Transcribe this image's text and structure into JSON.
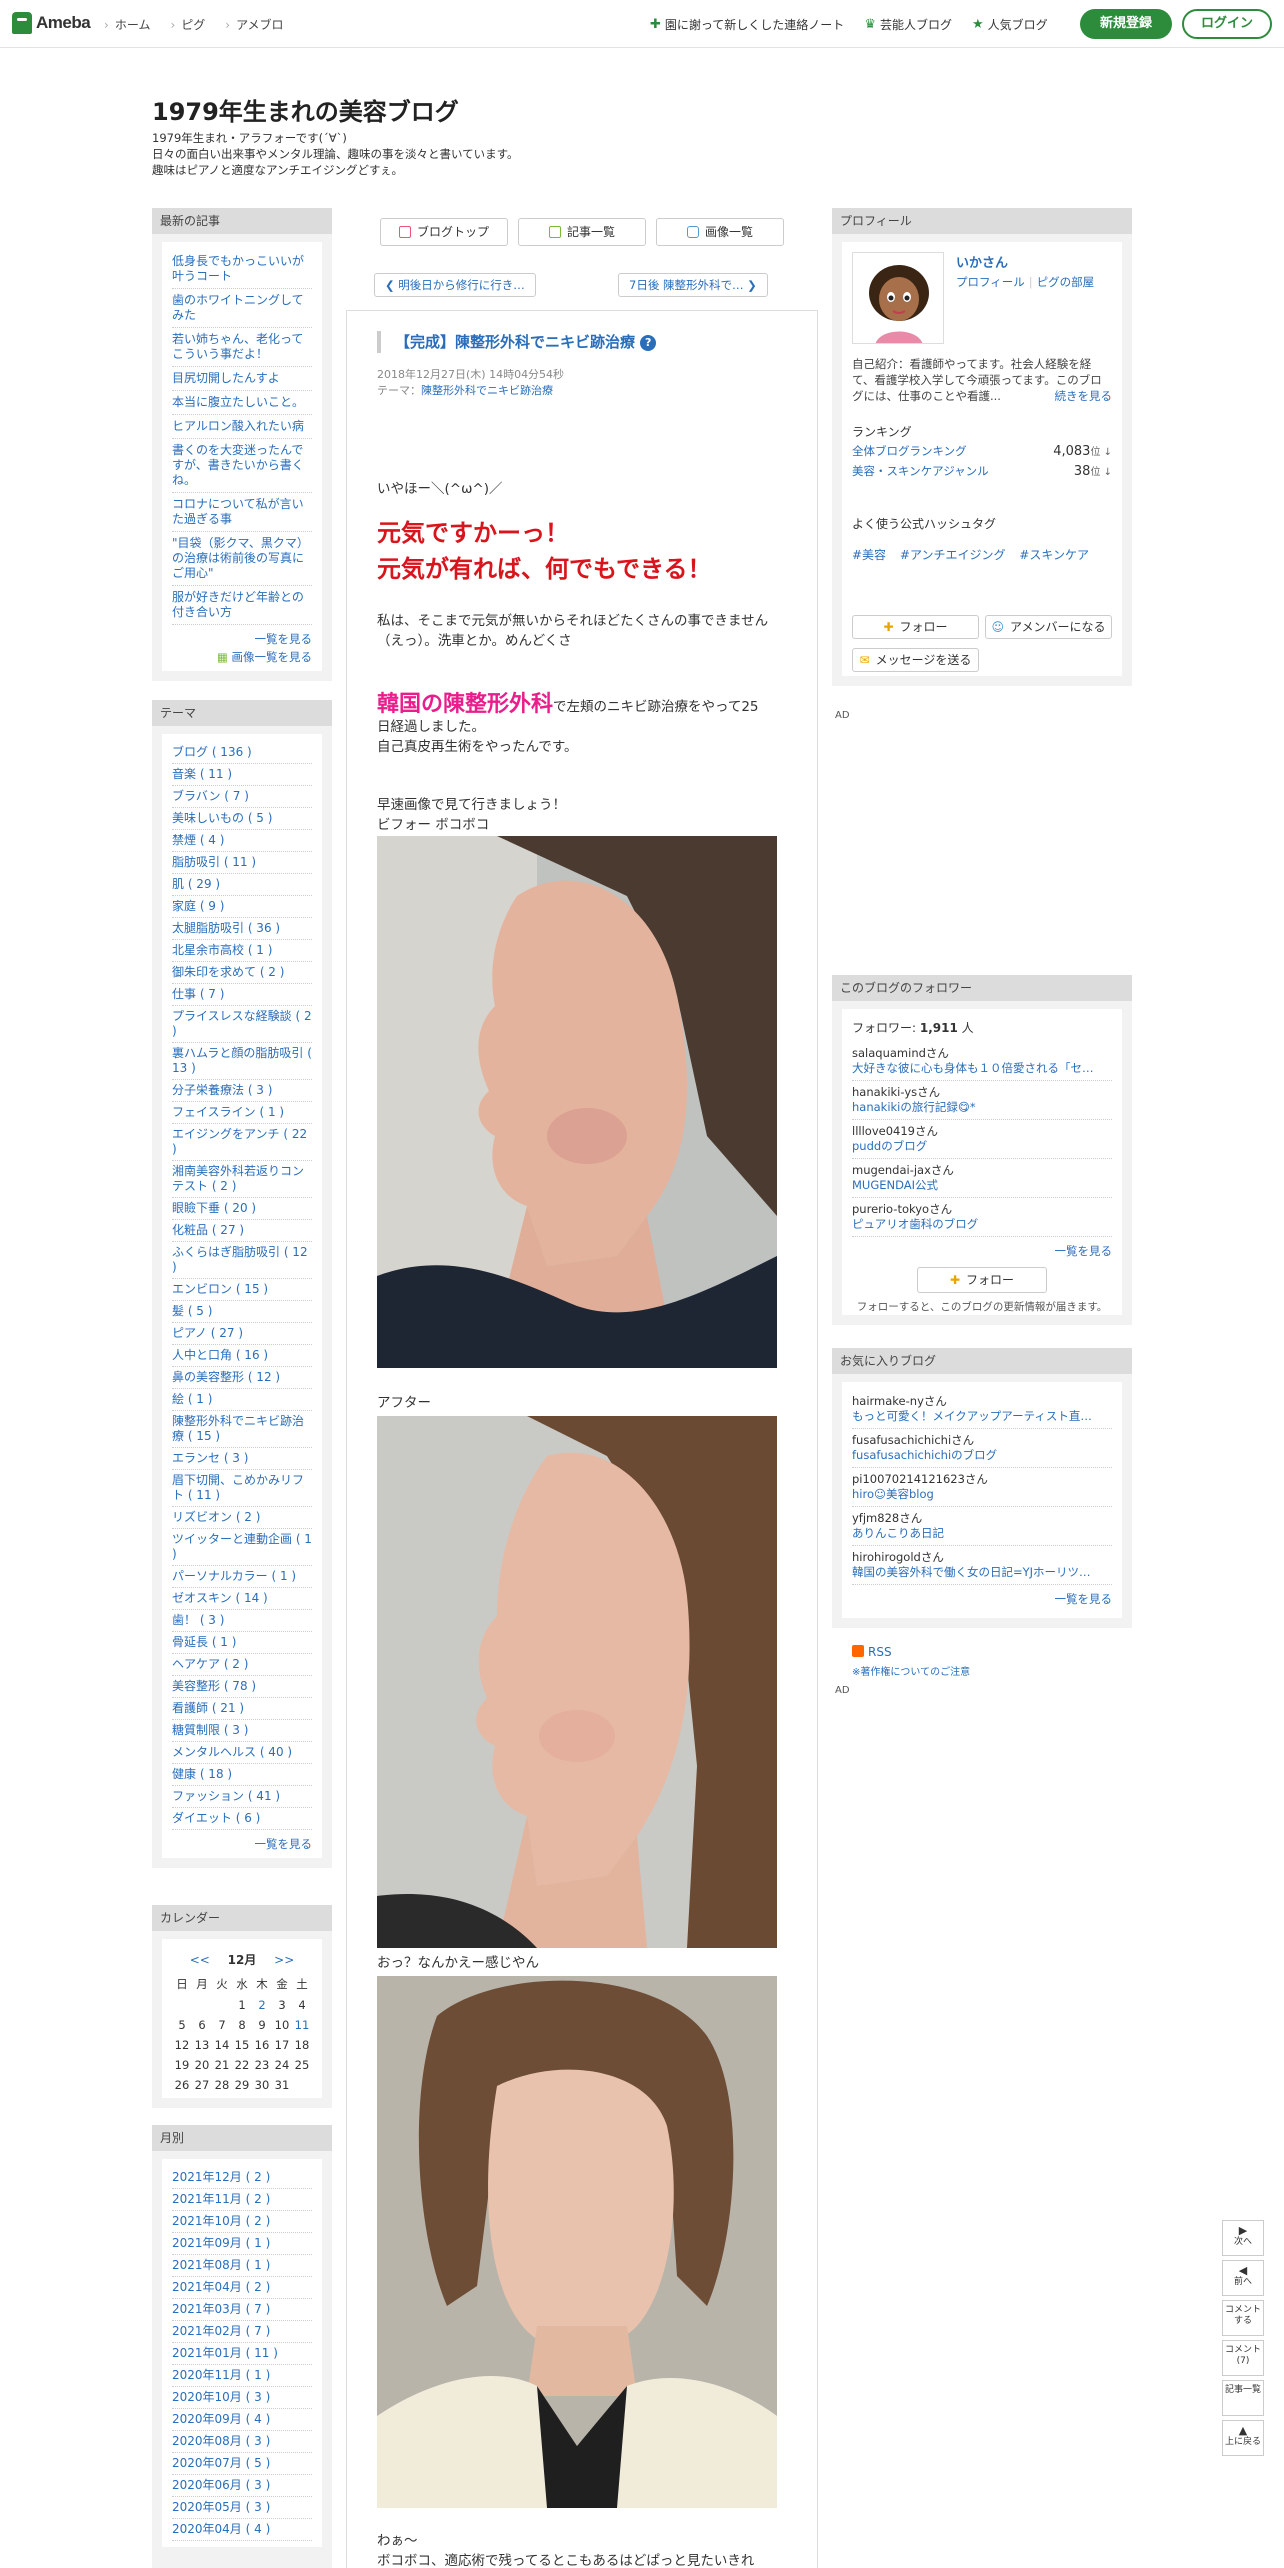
{
  "topbar": {
    "logo": "Ameba",
    "nav": [
      "ホーム",
      "ピグ",
      "アメブロ"
    ],
    "right": [
      {
        "icon": "plus-star-icon",
        "label": "園に謝って新しくした連絡ノート"
      },
      {
        "icon": "crown-icon",
        "label": "芸能人ブログ"
      },
      {
        "icon": "star-icon",
        "label": "人気ブログ"
      }
    ],
    "register": "新規登録",
    "login": "ログイン"
  },
  "header": {
    "title": "1979年生まれの美容ブログ",
    "desc": [
      "1979年生まれ・アラフォーです(´∀`)",
      "日々の面白い出来事やメンタル理論、趣味の事を淡々と書いています。",
      "趣味はピアノと適度なアンチエイジングどすぇ。"
    ]
  },
  "latest": {
    "heading": "最新の記事",
    "items": [
      "低身長でもかっこいいが叶うコート",
      "歯のホワイトニングしてみた",
      "若い姉ちゃん、老化ってこういう事だよ！",
      "目尻切開したんすよ",
      "本当に腹立たしいこと。",
      "ヒアルロン酸入れたい病",
      "書くのを大変迷ったんですが、書きたいから書くね。",
      "コロナについて私が言いた過ぎる事",
      "\"目袋（影クマ、黒クマ）の治療は術前後の写真にご用心\"",
      "服が好きだけど年齢との付き合い方"
    ],
    "more": "一覧を見る",
    "images": "画像一覧を見る"
  },
  "theme": {
    "heading": "テーマ",
    "items": [
      "ブログ ( 136 )",
      "音楽 ( 11 )",
      "ブラバン ( 7 )",
      "美味しいもの ( 5 )",
      "禁煙 ( 4 )",
      "脂肪吸引 ( 11 )",
      "肌 ( 29 )",
      "家庭 ( 9 )",
      "太腿脂肪吸引 ( 36 )",
      "北星余市高校 ( 1 )",
      "御朱印を求めて ( 2 )",
      "仕事 ( 7 )",
      "プライスレスな経験談 ( 2 )",
      "裏ハムラと顔の脂肪吸引 ( 13 )",
      "分子栄養療法 ( 3 )",
      "フェイスライン ( 1 )",
      "エイジングをアンチ ( 22 )",
      "湘南美容外科若返りコンテスト ( 2 )",
      "眼瞼下垂 ( 20 )",
      "化粧品 ( 27 )",
      "ふくらはぎ脂肪吸引 ( 12 )",
      "エンビロン ( 15 )",
      "髪 ( 5 )",
      "ピアノ ( 27 )",
      "人中と口角 ( 16 )",
      "鼻の美容整形 ( 12 )",
      "絵 ( 1 )",
      "陳整形外科でニキビ跡治療 ( 15 )",
      "エランセ ( 3 )",
      "眉下切開、こめかみリフト ( 11 )",
      "リズビオン ( 2 )",
      "ツイッターと連動企画 ( 1 )",
      "パーソナルカラー ( 1 )",
      "ゼオスキン ( 14 )",
      "歯！ ( 3 )",
      "骨延長 ( 1 )",
      "ヘアケア ( 2 )",
      "美容整形 ( 78 )",
      "看護師 ( 21 )",
      "糖質制限 ( 3 )",
      "メンタルヘルス ( 40 )",
      "健康 ( 18 )",
      "ファッション ( 41 )",
      "ダイエット ( 6 )"
    ],
    "more": "一覧を見る"
  },
  "calendar": {
    "heading": "カレンダー",
    "prev": "<<",
    "month": "12月",
    "next": ">>",
    "weekdays": [
      "日",
      "月",
      "火",
      "水",
      "木",
      "金",
      "土"
    ],
    "leading_blanks": 3,
    "days": 31,
    "linked_days": [
      2,
      11
    ]
  },
  "monthly": {
    "heading": "月別",
    "items": [
      "2021年12月 ( 2 )",
      "2021年11月 ( 2 )",
      "2021年10月 ( 2 )",
      "2021年09月 ( 1 )",
      "2021年08月 ( 1 )",
      "2021年04月 ( 2 )",
      "2021年03月 ( 7 )",
      "2021年02月 ( 7 )",
      "2021年01月 ( 11 )",
      "2020年11月 ( 1 )",
      "2020年10月 ( 3 )",
      "2020年09月 ( 4 )",
      "2020年08月 ( 3 )",
      "2020年07月 ( 5 )",
      "2020年06月 ( 3 )",
      "2020年05月 ( 3 )",
      "2020年04月 ( 4 )"
    ]
  },
  "center": {
    "tabs": [
      "ブログトップ",
      "記事一覧",
      "画像一覧"
    ],
    "prev": "明後日から修行に行き…",
    "next": "7日後 陳整形外科で…",
    "title": "【完成】陳整形外科でニキビ跡治療",
    "title_icon": "?",
    "date": "2018年12月27日(木) 14時04分54秒",
    "theme_label": "テーマ：",
    "theme": "陳整形外科でニキビ跡治療",
    "greet": "いやほー＼(^ω^)／",
    "big1": "元気ですかーっ！",
    "big2": "元気が有れば、何でもできる！",
    "p1a": "私は、そこまで元気が無いからそれほどたくさんの事できません",
    "p1b": "（えっ）。洗車とか。めんどくさ",
    "pink": "韓国の陳整形外科",
    "p2a": "で左頬のニキビ跡治療をやって25",
    "p2b": "日経過しました。",
    "p2c": "自己真皮再生術をやったんです。",
    "p3": "早速画像で見て行きましょう！",
    "before": "ビフォー ボコボコ",
    "after": "アフター",
    "ok": "おっ？なんかえー感じやん",
    "wa": "わぁ〜",
    "last": "ボコボコ、適応術で残ってるとこもあるはどぱっと見たいきれ"
  },
  "profile": {
    "heading": "プロフィール",
    "name": "いかさん",
    "link1": "プロフィール",
    "link2": "ピグの部屋",
    "intro": "自己紹介：看護師やってます。社会人経験を経て、看護学校入学して今頑張ってます。このブログには、仕事のことや看護...",
    "more": "続きを見る",
    "ranking_heading": "ランキング",
    "rank1_label": "全体ブログランキング",
    "rank1_value": "4,083",
    "rank2_label": "美容・スキンケアジャンル",
    "rank2_value": "38",
    "rank_unit": "位 ↓",
    "tag_heading": "よく使う公式ハッシュタグ",
    "tags": [
      "#美容",
      "#アンチエイジング",
      "#スキンケア"
    ],
    "follow": "フォロー",
    "member": "アメンバーになる",
    "message": "メッセージを送る"
  },
  "ad": "AD",
  "followers": {
    "heading": "このブログのフォロワー",
    "count_label": "フォロワー:",
    "count": "1,911",
    "count_unit": "人",
    "items": [
      {
        "name": "salaquamindさん",
        "blog": "大好きな彼に心も身体も１０倍愛される「セ…"
      },
      {
        "name": "hanakiki-ysさん",
        "blog": "hanakikiの旅行記録😋*"
      },
      {
        "name": "llllove0419さん",
        "blog": "puddのブログ"
      },
      {
        "name": "mugendai-jaxさん",
        "blog": "MUGENDAI公式"
      },
      {
        "name": "purerio-tokyoさん",
        "blog": "ピュアリオ歯科のブログ"
      }
    ],
    "more": "一覧を見る",
    "follow": "フォロー",
    "note": "フォローすると、このブログの更新情報が届きます。"
  },
  "favorites": {
    "heading": "お気に入りブログ",
    "items": [
      {
        "name": "hairmake-nyさん",
        "blog": "もっと可愛く！メイクアップアーティスト直…"
      },
      {
        "name": "fusafusachichichiさん",
        "blog": "fusafusachichichiのブログ"
      },
      {
        "name": "pi10070214121623さん",
        "blog": "hiro☺美容blog"
      },
      {
        "name": "yfjm828さん",
        "blog": "ありんこりあ日記"
      },
      {
        "name": "hirohirogoldさん",
        "blog": "韓国の美容外科で働く女の日記=YJホーリツ…"
      }
    ],
    "more": "一覧を見る"
  },
  "rss": "RSS",
  "copyright": "※著作権についてのご注意",
  "floatnav": [
    {
      "a": "▶",
      "t": "次へ"
    },
    {
      "a": "◀",
      "t": "前へ"
    },
    {
      "a": "",
      "t": "コメントする"
    },
    {
      "a": "",
      "t": "コメント(7)"
    },
    {
      "a": "",
      "t": "記事一覧"
    },
    {
      "a": "▲",
      "t": "上に戻る"
    }
  ]
}
